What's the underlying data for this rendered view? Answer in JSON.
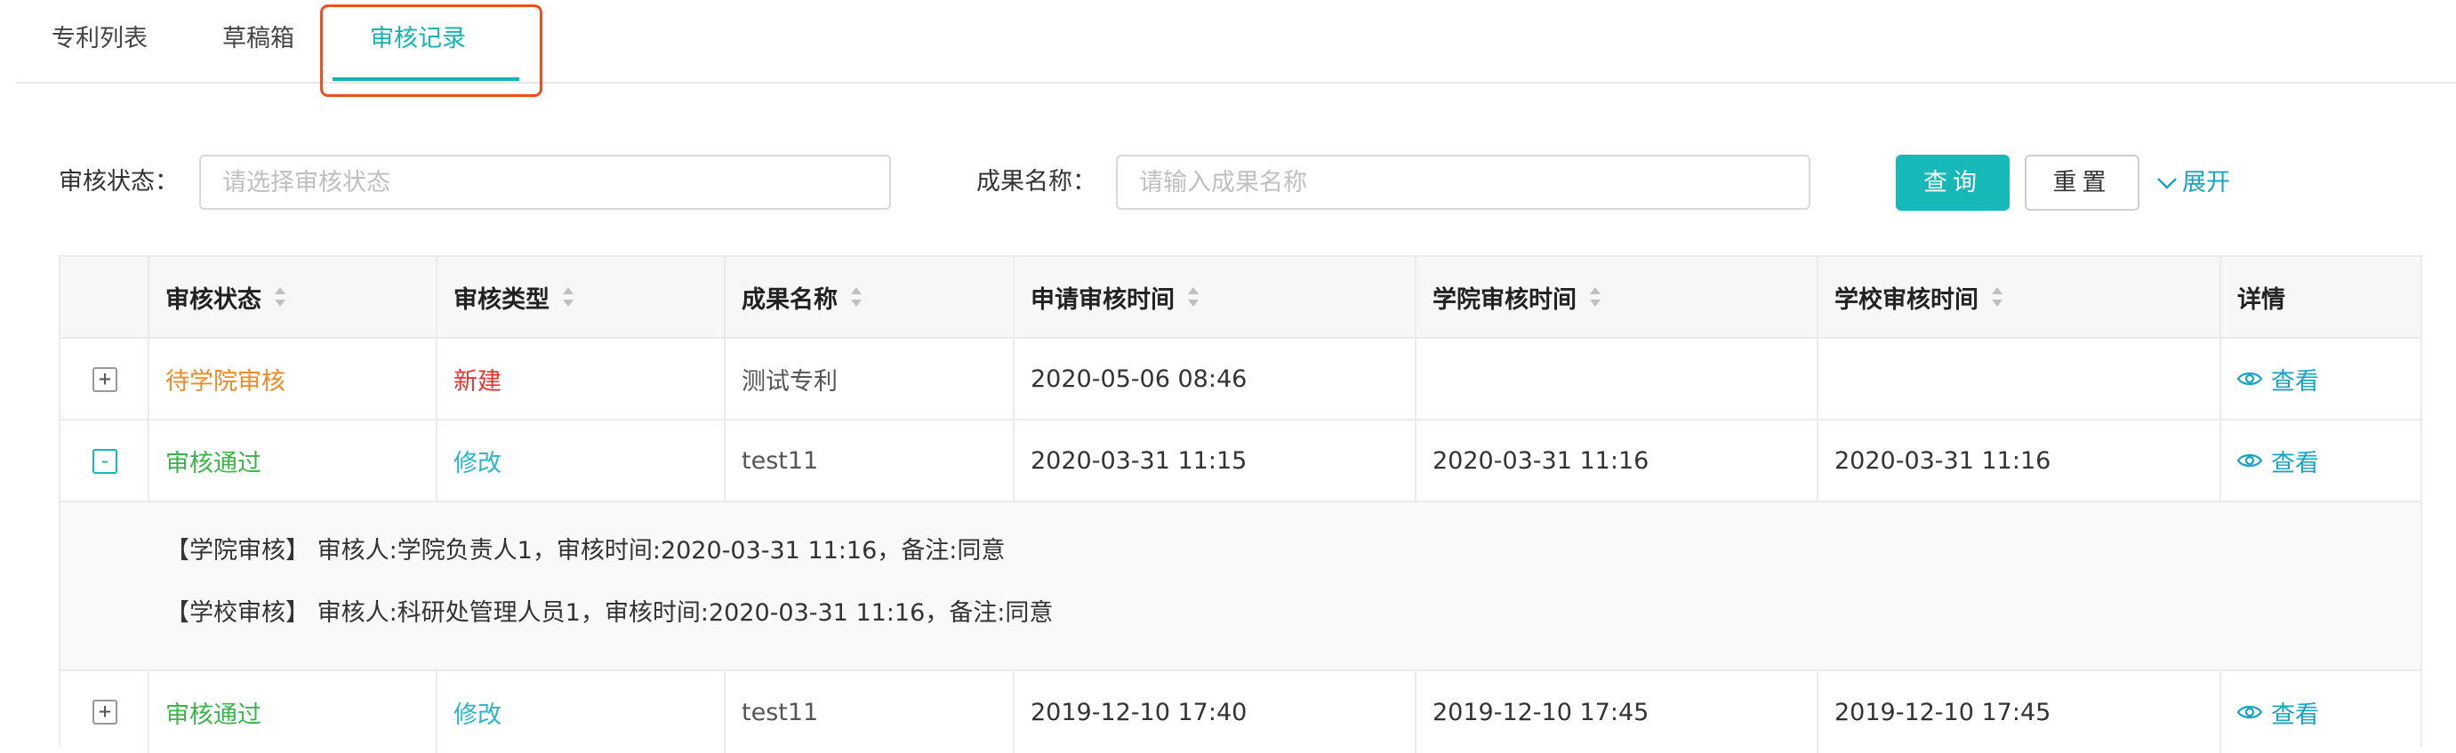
{
  "tabs": [
    {
      "label": "专利列表",
      "active": false
    },
    {
      "label": "草稿箱",
      "active": false
    },
    {
      "label": "审核记录",
      "active": true
    }
  ],
  "filters": {
    "status_label": "审核状态：",
    "status_placeholder": "请选择审核状态",
    "name_label": "成果名称：",
    "name_placeholder": "请输入成果名称",
    "query_label": "查询",
    "reset_label": "重置",
    "expand_label": "展开"
  },
  "table": {
    "headers": [
      "审核状态",
      "审核类型",
      "成果名称",
      "申请审核时间",
      "学院审核时间",
      "学校审核时间",
      "详情"
    ],
    "rows": [
      {
        "expander": "+",
        "status": "待学院审核",
        "type": "新建",
        "name": "测试专利",
        "apply_time": "2020-05-06 08:46",
        "college_time": "",
        "school_time": "",
        "detail": "查看"
      },
      {
        "expander": "-",
        "status": "审核通过",
        "type": "修改",
        "name": "test11",
        "apply_time": "2020-03-31 11:15",
        "college_time": "2020-03-31 11:16",
        "school_time": "2020-03-31 11:16",
        "detail": "查看"
      },
      {
        "expander": "+",
        "status": "审核通过",
        "type": "修改",
        "name": "test11",
        "apply_time": "2019-12-10 17:40",
        "college_time": "2019-12-10 17:45",
        "school_time": "2019-12-10 17:45",
        "detail": "查看"
      }
    ],
    "expanded_details": [
      "【学院审核】 审核人:学院负责人1，审核时间:2020-03-31 11:16，备注:同意",
      "【学校审核】 审核人:科研处管理人员1，审核时间:2020-03-31 11:16，备注:同意"
    ]
  },
  "colors": {
    "accent": "#17b8b8",
    "link": "#17a5c3",
    "pending": "#f08a24",
    "approved": "#3bb54a",
    "new": "#f0312d",
    "modify": "#2ab7c9",
    "highlight": "#f04e1e"
  }
}
